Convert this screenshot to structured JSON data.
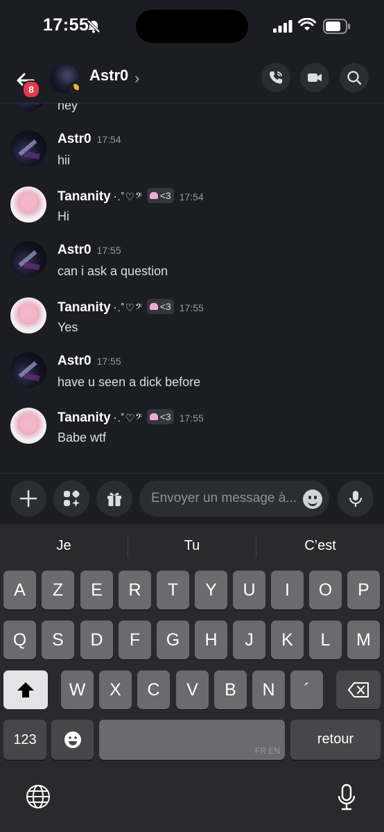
{
  "status_bar": {
    "time": "17:55"
  },
  "header": {
    "unread_badge": "8",
    "contact_name": "Astr0",
    "chevron": "›"
  },
  "messages": [
    {
      "author": "",
      "deco": "",
      "tag": "",
      "time": "",
      "text": "hey",
      "avatar": "astro"
    },
    {
      "author": "Astr0",
      "deco": "",
      "tag": "",
      "time": "17:54",
      "text": "hii",
      "avatar": "astro"
    },
    {
      "author": "Tananity",
      "deco": "⋅.˚♡𝄢",
      "tag": "<3",
      "time": "17:54",
      "text": "Hi",
      "avatar": "tananity"
    },
    {
      "author": "Astr0",
      "deco": "",
      "tag": "",
      "time": "17:55",
      "text": "can i ask a question",
      "avatar": "astro"
    },
    {
      "author": "Tananity",
      "deco": "⋅.˚♡𝄢",
      "tag": "<3",
      "time": "17:55",
      "text": "Yes",
      "avatar": "tananity"
    },
    {
      "author": "Astr0",
      "deco": "",
      "tag": "",
      "time": "17:55",
      "text": "have u seen a dick before",
      "avatar": "astro"
    },
    {
      "author": "Tananity",
      "deco": "⋅.˚♡𝄢",
      "tag": "<3",
      "time": "17:55",
      "text": "Babe wtf",
      "avatar": "tananity"
    }
  ],
  "composer": {
    "placeholder": "Envoyer un message à..."
  },
  "keyboard": {
    "suggestions": [
      "Je",
      "Tu",
      "C’est"
    ],
    "row1": [
      "A",
      "Z",
      "E",
      "R",
      "T",
      "Y",
      "U",
      "I",
      "O",
      "P"
    ],
    "row2": [
      "Q",
      "S",
      "D",
      "F",
      "G",
      "H",
      "J",
      "K",
      "L",
      "M"
    ],
    "row3": [
      "W",
      "X",
      "C",
      "V",
      "B",
      "N",
      "´"
    ],
    "numbers_key": "123",
    "return_key": "retour",
    "language": "FR EN"
  }
}
